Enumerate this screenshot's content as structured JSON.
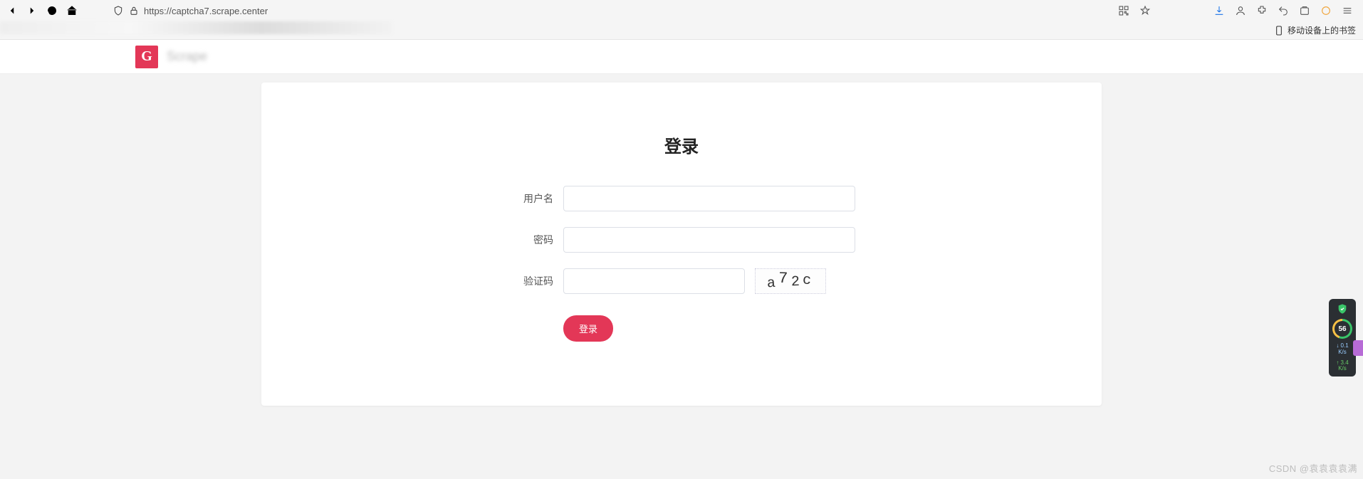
{
  "browser": {
    "url": "https://captcha7.scrape.center",
    "bookmark_label": "移动设备上的书签"
  },
  "header": {
    "brand": "Scrape"
  },
  "form": {
    "title": "登录",
    "username_label": "用户名",
    "password_label": "密码",
    "captcha_label": "验证码",
    "captcha_chars": {
      "c1": "a",
      "c2": "7",
      "c3": "2",
      "c4": "c"
    },
    "login_button": "登录"
  },
  "widget": {
    "score": "56",
    "net_down": "0.1",
    "net_down_unit": "K/s",
    "net_up": "3.4",
    "net_up_unit": "K/s"
  },
  "watermark": "CSDN @袁袁袁袁满"
}
